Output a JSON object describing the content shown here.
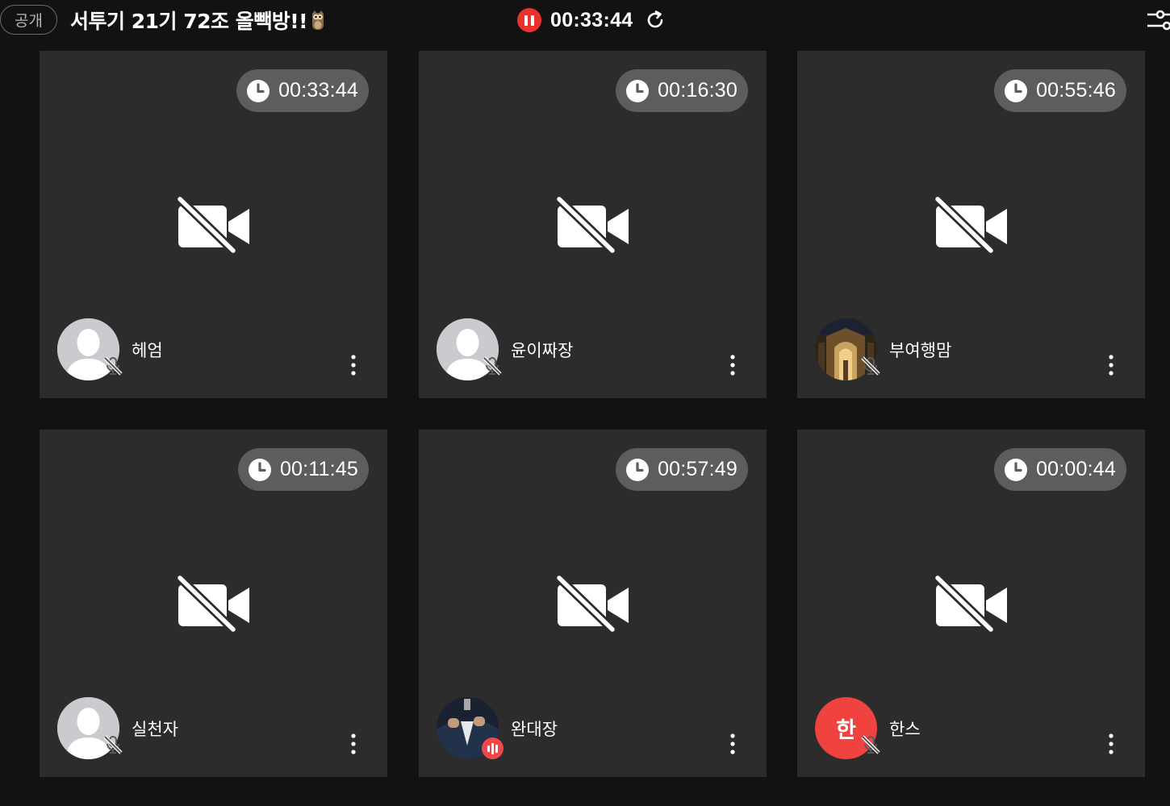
{
  "header": {
    "visibility_badge": "공개",
    "room_title": "서투기 21기 72조 올빽방!!",
    "owl_icon": "owl-icon",
    "recording_time": "00:33:44",
    "record_icon": "pause-icon",
    "refresh_icon": "refresh-icon",
    "settings_icon": "sliders-icon"
  },
  "colors": {
    "background": "#121212",
    "tile": "#2c2c2c",
    "timer_pill": "#5d5d5d",
    "record_red": "#e8332d",
    "initial_avatar": "#f0433f"
  },
  "participants": [
    {
      "name": "헤엄",
      "timer": "00:33:44",
      "avatar": "default-silhouette",
      "mic": "muted",
      "camera": "off"
    },
    {
      "name": "윤이짜장",
      "timer": "00:16:30",
      "avatar": "default-silhouette",
      "mic": "muted",
      "camera": "off"
    },
    {
      "name": "부여행맘",
      "timer": "00:55:46",
      "avatar": "photo-doorway",
      "mic": "muted",
      "camera": "off"
    },
    {
      "name": "실천자",
      "timer": "00:11:45",
      "avatar": "default-silhouette",
      "mic": "muted",
      "camera": "off"
    },
    {
      "name": "완대장",
      "timer": "00:57:49",
      "avatar": "photo-suit",
      "mic": "speaking",
      "camera": "off"
    },
    {
      "name": "한스",
      "timer": "00:00:44",
      "avatar": "initial",
      "avatar_initial": "한",
      "mic": "muted",
      "camera": "off"
    }
  ]
}
